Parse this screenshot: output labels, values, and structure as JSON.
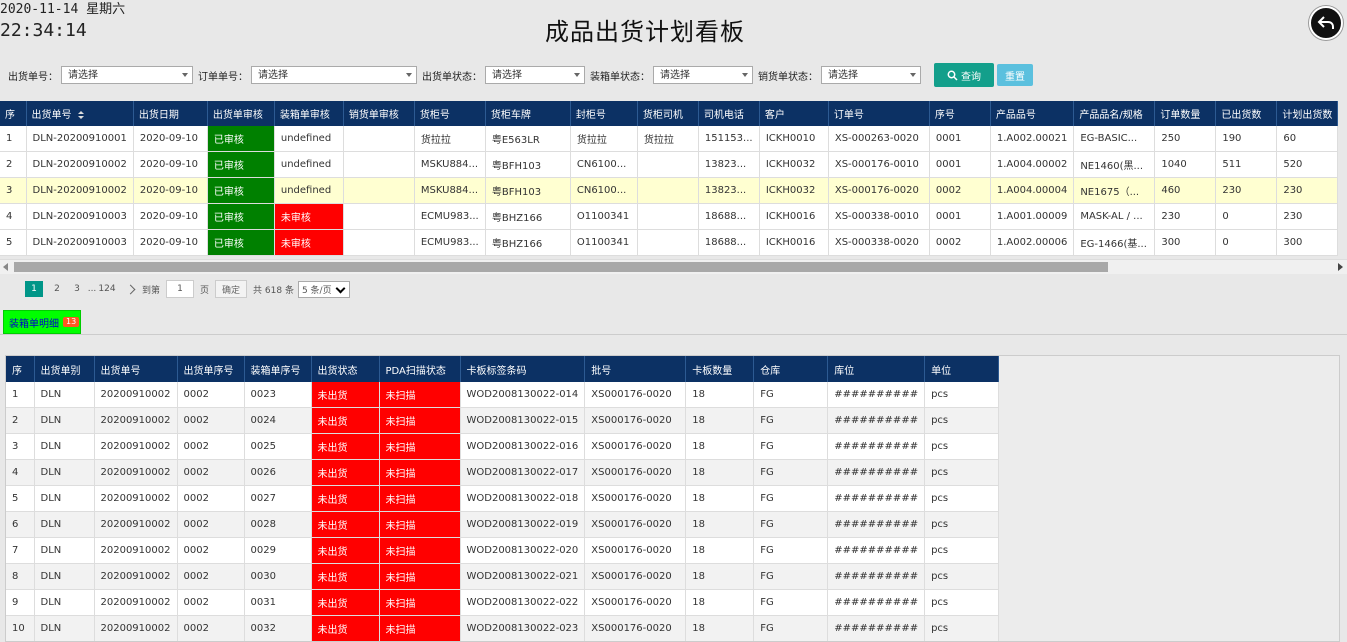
{
  "datetime": {
    "date": "2020-11-14 星期六",
    "time": "22:34:14"
  },
  "title": "成品出货计划看板",
  "filters": [
    {
      "label": "出货单号：",
      "placeholder": "请选择"
    },
    {
      "label": "订单单号：",
      "placeholder": "请选择"
    },
    {
      "label": "出货单状态：",
      "placeholder": "请选择"
    },
    {
      "label": "装箱单状态：",
      "placeholder": "请选择"
    },
    {
      "label": "销货单状态：",
      "placeholder": "请选择"
    }
  ],
  "buttons": {
    "query": "查询",
    "reset": "重置"
  },
  "main_table": {
    "headers": [
      "序",
      "出货单号",
      "出货日期",
      "出货单审核",
      "装箱单审核",
      "销货单审核",
      "货柜号",
      "货柜车牌",
      "封柜号",
      "货柜司机",
      "司机电话",
      "客户",
      "订单号",
      "序号",
      "产品品号",
      "产品品名/规格",
      "订单数量",
      "已出货数",
      "计划出货数"
    ],
    "rows": [
      [
        "1",
        "DLN-20200910001",
        "2020-09-10",
        "已审核",
        "undefined",
        "",
        "货拉拉",
        "粤E563LR",
        "货拉拉",
        "货拉拉",
        "151153...",
        "ICKH0010",
        "XS-000263-0020",
        "0001",
        "1.A002.00021",
        "EG-BASIC...",
        "250",
        "190",
        "60"
      ],
      [
        "2",
        "DLN-20200910002",
        "2020-09-10",
        "已审核",
        "undefined",
        "",
        "MSKU884...",
        "粤BFH103",
        "CN6100...",
        "",
        "13823...",
        "ICKH0032",
        "XS-000176-0010",
        "0001",
        "1.A004.00002",
        "NE1460(黑...",
        "1040",
        "511",
        "520"
      ],
      [
        "3",
        "DLN-20200910002",
        "2020-09-10",
        "已审核",
        "undefined",
        "",
        "MSKU884...",
        "粤BFH103",
        "CN6100...",
        "",
        "13823...",
        "ICKH0032",
        "XS-000176-0020",
        "0002",
        "1.A004.00004",
        "NE1675（...",
        "460",
        "230",
        "230"
      ],
      [
        "4",
        "DLN-20200910003",
        "2020-09-10",
        "已审核",
        "未审核",
        "",
        "ECMU983...",
        "粤BHZ166",
        "O1100341",
        "",
        "18688...",
        "ICKH0016",
        "XS-000338-0010",
        "0001",
        "1.A001.00009",
        "MASK-AL / ...",
        "230",
        "0",
        "230"
      ],
      [
        "5",
        "DLN-20200910003",
        "2020-09-10",
        "已审核",
        "未审核",
        "",
        "ECMU983...",
        "粤BHZ166",
        "O1100341",
        "",
        "18688...",
        "ICKH0016",
        "XS-000338-0020",
        "0002",
        "1.A002.00006",
        "EG-1466(基...",
        "300",
        "0",
        "300"
      ]
    ]
  },
  "pagination": {
    "pages": [
      "1",
      "2",
      "3"
    ],
    "ellipsis": "...",
    "last": "124",
    "goto_label": "到第",
    "goto_value": "1",
    "page_unit": "页",
    "confirm": "确定",
    "total": "共 618 条",
    "page_size": "5 条/页"
  },
  "tab": {
    "label": "装箱单明细",
    "badge": "13"
  },
  "detail_table": {
    "headers": [
      "序",
      "出货单别",
      "出货单号",
      "出货单序号",
      "装箱单序号",
      "出货状态",
      "PDA扫描状态",
      "卡板标签条码",
      "批号",
      "卡板数量",
      "仓库",
      "库位",
      "单位"
    ],
    "rows": [
      [
        "1",
        "DLN",
        "20200910002",
        "0002",
        "0023",
        "未出货",
        "未扫描",
        "WOD2008130022-014",
        "XS000176-0020",
        "18",
        "FG",
        "##########",
        "pcs"
      ],
      [
        "2",
        "DLN",
        "20200910002",
        "0002",
        "0024",
        "未出货",
        "未扫描",
        "WOD2008130022-015",
        "XS000176-0020",
        "18",
        "FG",
        "##########",
        "pcs"
      ],
      [
        "3",
        "DLN",
        "20200910002",
        "0002",
        "0025",
        "未出货",
        "未扫描",
        "WOD2008130022-016",
        "XS000176-0020",
        "18",
        "FG",
        "##########",
        "pcs"
      ],
      [
        "4",
        "DLN",
        "20200910002",
        "0002",
        "0026",
        "未出货",
        "未扫描",
        "WOD2008130022-017",
        "XS000176-0020",
        "18",
        "FG",
        "##########",
        "pcs"
      ],
      [
        "5",
        "DLN",
        "20200910002",
        "0002",
        "0027",
        "未出货",
        "未扫描",
        "WOD2008130022-018",
        "XS000176-0020",
        "18",
        "FG",
        "##########",
        "pcs"
      ],
      [
        "6",
        "DLN",
        "20200910002",
        "0002",
        "0028",
        "未出货",
        "未扫描",
        "WOD2008130022-019",
        "XS000176-0020",
        "18",
        "FG",
        "##########",
        "pcs"
      ],
      [
        "7",
        "DLN",
        "20200910002",
        "0002",
        "0029",
        "未出货",
        "未扫描",
        "WOD2008130022-020",
        "XS000176-0020",
        "18",
        "FG",
        "##########",
        "pcs"
      ],
      [
        "8",
        "DLN",
        "20200910002",
        "0002",
        "0030",
        "未出货",
        "未扫描",
        "WOD2008130022-021",
        "XS000176-0020",
        "18",
        "FG",
        "##########",
        "pcs"
      ],
      [
        "9",
        "DLN",
        "20200910002",
        "0002",
        "0031",
        "未出货",
        "未扫描",
        "WOD2008130022-022",
        "XS000176-0020",
        "18",
        "FG",
        "##########",
        "pcs"
      ],
      [
        "10",
        "DLN",
        "20200910002",
        "0002",
        "0032",
        "未出货",
        "未扫描",
        "WOD2008130022-023",
        "XS000176-0020",
        "18",
        "FG",
        "##########",
        "pcs"
      ]
    ]
  },
  "colors": {
    "header_bg": "#0c3164",
    "approved": "#008000",
    "not_approved": "#ff0000",
    "highlight_row": "#ffffd1",
    "query_btn": "#139f8b",
    "reset_btn": "#5bc0de",
    "tab_bg": "#00ff00"
  }
}
